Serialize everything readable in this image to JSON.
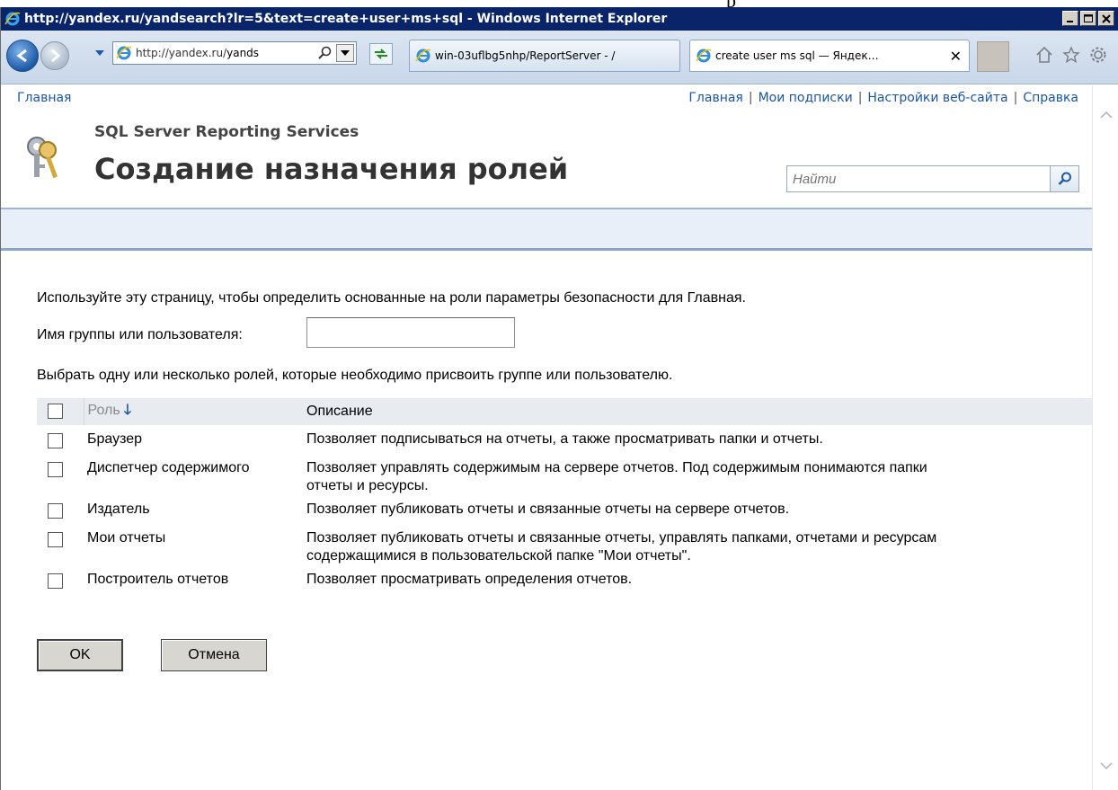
{
  "window": {
    "title": "http://yandex.ru/yandsearch?lr=5&text=create+user+ms+sql - Windows Internet Explorer"
  },
  "navbar": {
    "address_prefix": "http://yandex.ru/",
    "address_rest": "yands",
    "tabs": [
      {
        "label": "win-03uflbg5nhp/ReportServer - /"
      },
      {
        "label": "create user ms sql — Яндек…"
      }
    ]
  },
  "page": {
    "breadcrumb": "Главная",
    "top_links": [
      "Главная",
      "Мои подписки",
      "Настройки веб-сайта",
      "Справка"
    ],
    "product_name": "SQL Server Reporting Services",
    "title": "Создание назначения ролей",
    "search_placeholder": "Найти",
    "intro": "Используйте эту страницу, чтобы определить основанные на роли параметры безопасности для Главная.",
    "username_label": "Имя группы или пользователя:",
    "username_value": "",
    "roles_intro": "Выбрать одну или несколько ролей, которые необходимо присвоить группе или пользователю.",
    "table_headers": {
      "role": "Роль",
      "role_sort_icon": "sort-down-arrow",
      "description": "Описание"
    },
    "roles": [
      {
        "name": "Браузер",
        "description_lines": [
          "Позволяет подписываться на отчеты, а также просматривать папки и отчеты."
        ],
        "checked": false
      },
      {
        "name": "Диспетчер содержимого",
        "description_lines": [
          "Позволяет управлять содержимым на сервере отчетов. Под содержимым понимаются папки",
          "отчеты и ресурсы."
        ],
        "checked": false
      },
      {
        "name": "Издатель",
        "description_lines": [
          "Позволяет публиковать отчеты и связанные отчеты на сервере отчетов."
        ],
        "checked": false
      },
      {
        "name": "Мои отчеты",
        "description_lines": [
          "Позволяет публиковать отчеты и связанные отчеты, управлять папками, отчетами и ресурсам",
          "содержащимися в пользовательской папке \"Мои отчеты\"."
        ],
        "checked": false
      },
      {
        "name": "Построитель отчетов",
        "description_lines": [
          "Позволяет просматривать определения отчетов."
        ],
        "checked": false
      }
    ],
    "ok_label": "OK",
    "cancel_label": "Отмена"
  },
  "colors": {
    "link": "#1a56a8",
    "titlebar": "#0a246a"
  }
}
